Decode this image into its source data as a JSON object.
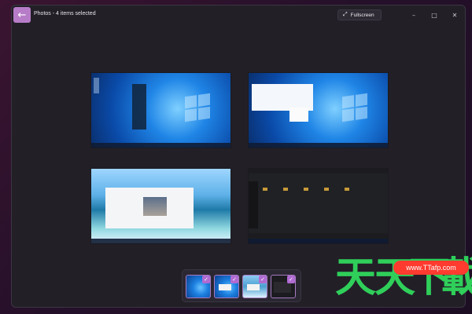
{
  "app": {
    "title": "Photos - 4 items selected",
    "back_icon": "arrow-left-icon",
    "fullscreen_label": "Fullscreen",
    "fullscreen_icon": "expand-diagonal-icon"
  },
  "window_controls": {
    "minimize": "–",
    "maximize": "□",
    "close": "✕"
  },
  "thumbnails": [
    {
      "selected": true,
      "check_glyph": "✓"
    },
    {
      "selected": true,
      "check_glyph": "✓"
    },
    {
      "selected": true,
      "check_glyph": "✓"
    },
    {
      "selected": true,
      "check_glyph": "✓"
    }
  ],
  "watermark": {
    "text": "www.TTafp.com",
    "glyph_1": "天",
    "glyph_2": "天",
    "glyph_3": "下",
    "glyph_4": "載"
  },
  "colors": {
    "accent": "#b77cc8",
    "background": "#221f27",
    "watermark_green": "#2fcf5a",
    "watermark_red": "#ff3b2f"
  }
}
